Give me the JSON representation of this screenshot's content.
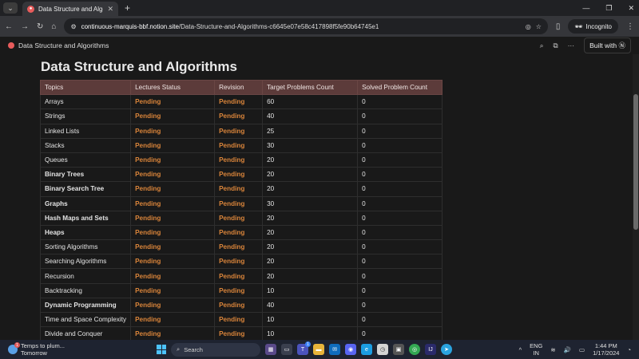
{
  "browser": {
    "tab_title": "Data Structure and Algorithms",
    "tab_menu_icon": "chevron-down-icon",
    "url_host": "continuous-marquis-bbf.notion.site",
    "url_path": "/Data-Structure-and-Algorithms-c6645e07e58c417898f5fe90b64745e1",
    "incognito_label": "Incognito"
  },
  "notion": {
    "page_name": "Data Structure and Algorithms",
    "built_with": "Built with",
    "more": "···"
  },
  "page": {
    "title": "Data Structure and Algorithms",
    "headers": [
      "Topics",
      "Lectures Status",
      "Revision",
      "Target Problems Count",
      "Solved Problem Count"
    ],
    "rows": [
      {
        "topic": "Arrays",
        "bold": false,
        "lecture": "Pending",
        "revision": "Pending",
        "target": "60",
        "solved": "0"
      },
      {
        "topic": "Strings",
        "bold": false,
        "lecture": "Pending",
        "revision": "Pending",
        "target": "40",
        "solved": "0"
      },
      {
        "topic": "Linked Lists",
        "bold": false,
        "lecture": "Pending",
        "revision": "Pending",
        "target": "25",
        "solved": "0"
      },
      {
        "topic": "Stacks",
        "bold": false,
        "lecture": "Pending",
        "revision": "Pending",
        "target": "30",
        "solved": "0"
      },
      {
        "topic": "Queues",
        "bold": false,
        "lecture": "Pending",
        "revision": "Pending",
        "target": "20",
        "solved": "0"
      },
      {
        "topic": "Binary Trees",
        "bold": true,
        "lecture": "Pending",
        "revision": "Pending",
        "target": "20",
        "solved": "0"
      },
      {
        "topic": "Binary Search Tree",
        "bold": true,
        "lecture": "Pending",
        "revision": "Pending",
        "target": "20",
        "solved": "0"
      },
      {
        "topic": "Graphs",
        "bold": true,
        "lecture": "Pending",
        "revision": "Pending",
        "target": "30",
        "solved": "0"
      },
      {
        "topic": "Hash Maps and Sets",
        "bold": true,
        "lecture": "Pending",
        "revision": "Pending",
        "target": "20",
        "solved": "0"
      },
      {
        "topic": "Heaps",
        "bold": true,
        "lecture": "Pending",
        "revision": "Pending",
        "target": "20",
        "solved": "0"
      },
      {
        "topic": "Sorting Algorithms",
        "bold": false,
        "lecture": "Pending",
        "revision": "Pending",
        "target": "20",
        "solved": "0"
      },
      {
        "topic": "Searching Algorithms",
        "bold": false,
        "lecture": "Pending",
        "revision": "Pending",
        "target": "20",
        "solved": "0"
      },
      {
        "topic": "Recursion",
        "bold": false,
        "lecture": "Pending",
        "revision": "Pending",
        "target": "20",
        "solved": "0"
      },
      {
        "topic": "Backtracking",
        "bold": false,
        "lecture": "Pending",
        "revision": "Pending",
        "target": "10",
        "solved": "0"
      },
      {
        "topic": "Dynamic Programming",
        "bold": true,
        "lecture": "Pending",
        "revision": "Pending",
        "target": "40",
        "solved": "0"
      },
      {
        "topic": "Time and Space Complexity",
        "bold": false,
        "lecture": "Pending",
        "revision": "Pending",
        "target": "10",
        "solved": "0"
      },
      {
        "topic": "Divide and Conquer",
        "bold": false,
        "lecture": "Pending",
        "revision": "Pending",
        "target": "10",
        "solved": "0"
      }
    ]
  },
  "colors": {
    "header_bg": "#5c3b3a",
    "pending": "#d9843a",
    "background": "#191919"
  },
  "taskbar": {
    "weather_line1": "Temps to plum...",
    "weather_line2": "Tomorrow",
    "weather_badge": "1",
    "search_placeholder": "Search",
    "lang_line1": "ENG",
    "lang_line2": "IN",
    "time": "1:44 PM",
    "date": "1/17/2024",
    "teams_badge": "1"
  }
}
